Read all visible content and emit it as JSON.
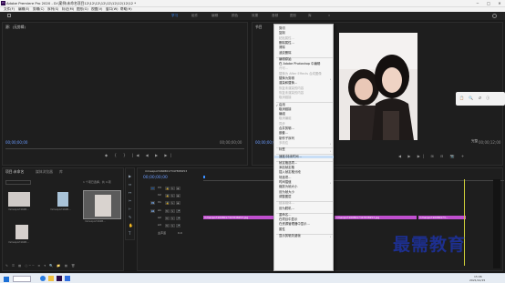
{
  "window": {
    "title": "Adobe Premiere Pro 2020 - D:\\案例\\未命名项目12\\12\\12\\12\\12\\12\\12\\12\\12 *"
  },
  "menubar": [
    "文件(F)",
    "编辑(E)",
    "剪辑(C)",
    "序列(S)",
    "标记(M)",
    "图形(G)",
    "视图(V)",
    "窗口(W)",
    "帮助(H)"
  ],
  "workspaces": {
    "items": [
      "学习",
      "组件",
      "编辑",
      "颜色",
      "效果",
      "音频",
      "图形",
      "库"
    ],
    "active": "学习",
    "more": "»"
  },
  "source_monitor": {
    "title": "源：(无剪辑)",
    "timecode_left": "00;00;00;00",
    "timecode_right": "00;00;00;00"
  },
  "program_monitor": {
    "fit": "完整",
    "timecode": "00;00;12;00"
  },
  "project_panel": {
    "tabs": [
      "项目:未命名",
      "媒体浏览器",
      "库"
    ],
    "count": "1 个项已选择，共 4 项",
    "items": [
      "mmexport1608...",
      "mmexport1608...",
      "mmexport1608...",
      "mmexport1608..."
    ]
  },
  "timeline": {
    "sequence_tab": "mmexport1608017347838253",
    "timecode": "00;00;00;00",
    "tracks": [
      "V3",
      "V2",
      "V1",
      "A1",
      "A2",
      "A3"
    ],
    "master": "主声道",
    "master_value": "0.0",
    "clips": [
      "mmexport1608017347838253.jpg",
      "mmexport1608017347838253.jpg",
      "mmexport16080173..."
    ]
  },
  "context_menu": {
    "items": [
      {
        "label": "剪切",
        "disabled": false
      },
      {
        "label": "复制",
        "disabled": false
      },
      {
        "label": "粘贴属性...",
        "disabled": true
      },
      {
        "label": "删除属性...",
        "disabled": false
      },
      {
        "label": "清除",
        "disabled": false
      },
      {
        "label": "波纹删除",
        "disabled": false
      },
      {
        "sep": true
      },
      {
        "label": "编辑原始",
        "disabled": false
      },
      {
        "label": "在 Adobe Photoshop 中编辑",
        "disabled": false
      },
      {
        "label": "许可...",
        "disabled": true
      },
      {
        "label": "替换为 After Effects 合成图像",
        "disabled": true
      },
      {
        "label": "替换为剪辑",
        "disabled": false,
        "submenu": true
      },
      {
        "label": "渲染和替换...",
        "disabled": false
      },
      {
        "label": "恢复未渲染的内容",
        "disabled": true
      },
      {
        "label": "恢复未渲染的内容",
        "disabled": true
      },
      {
        "label": "取消链接",
        "disabled": true
      },
      {
        "sep": true
      },
      {
        "label": "启用",
        "disabled": false,
        "checked": true
      },
      {
        "label": "取消链接",
        "disabled": false
      },
      {
        "label": "编组",
        "disabled": false
      },
      {
        "label": "取消编组",
        "disabled": true
      },
      {
        "label": "同步",
        "disabled": true
      },
      {
        "label": "合并剪辑...",
        "disabled": false
      },
      {
        "label": "嵌套...",
        "disabled": false
      },
      {
        "label": "制作子序列",
        "disabled": false
      },
      {
        "label": "多机位",
        "disabled": true,
        "submenu": true
      },
      {
        "sep": true
      },
      {
        "label": "标签",
        "disabled": false,
        "submenu": true
      },
      {
        "sep": true
      },
      {
        "label": "速度/持续时间...",
        "disabled": false,
        "highlight": true
      },
      {
        "sep": true
      },
      {
        "label": "帧定格选项...",
        "disabled": false
      },
      {
        "label": "添加帧定格",
        "disabled": false
      },
      {
        "label": "插入帧定格分段",
        "disabled": false
      },
      {
        "label": "场选项...",
        "disabled": false
      },
      {
        "label": "时间插值",
        "disabled": false,
        "submenu": true
      },
      {
        "label": "缩放为帧大小",
        "disabled": false
      },
      {
        "label": "设为帧大小",
        "disabled": false
      },
      {
        "label": "调整图层",
        "disabled": false
      },
      {
        "sep": true
      },
      {
        "label": "链接媒体...",
        "disabled": true
      },
      {
        "label": "设为脱机...",
        "disabled": false
      },
      {
        "sep": true
      },
      {
        "label": "重命名...",
        "disabled": false
      },
      {
        "label": "在项目中显示",
        "disabled": false
      },
      {
        "label": "在资源管理器中显示...",
        "disabled": false
      },
      {
        "label": "属性",
        "disabled": false
      },
      {
        "sep": true
      },
      {
        "label": "显示剪辑关键帧",
        "disabled": false,
        "submenu": true
      }
    ]
  },
  "watermark": "最需教育",
  "taskbar": {
    "time": "15:06",
    "date": "2021/12/15"
  },
  "colors": {
    "accent": "#3a8eff",
    "clip": "#c04fcf",
    "highlight": "#c8def6",
    "watermark": "#1d2f8f"
  }
}
